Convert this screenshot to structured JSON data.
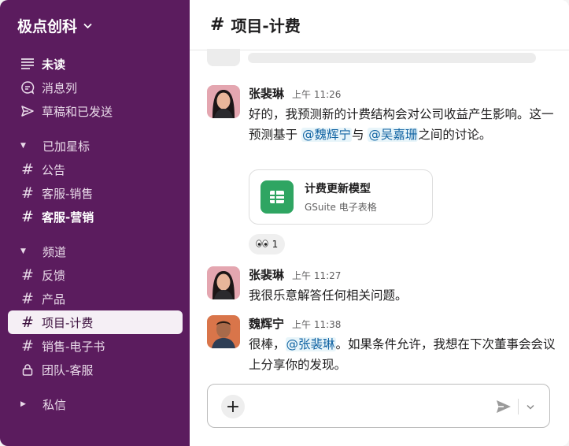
{
  "workspace": {
    "name": "极点创科"
  },
  "sidebar": {
    "top_items": [
      {
        "label": "未读",
        "icon": "unread-icon"
      },
      {
        "label": "消息列",
        "icon": "threads-icon"
      },
      {
        "label": "草稿和已发送",
        "icon": "send-icon"
      }
    ],
    "starred_section": "已加星标",
    "starred": [
      "公告",
      "客服-销售",
      "客服-营销"
    ],
    "channels_section": "频道",
    "channels": [
      "反馈",
      "产品",
      "项目-计费",
      "销售-电子书",
      "团队-客服"
    ],
    "dm_section": "私信"
  },
  "channel": {
    "name": "项目-计费",
    "hash": "#"
  },
  "messages": [
    {
      "author": "张裴琳",
      "time": "上午 11:26",
      "text_a": "好的，我预测新的计费结构会对公司收益产生影响。这一预测基于 ",
      "mention1": "@魏辉宁",
      "text_b": "与 ",
      "mention2": "@吴嘉珊",
      "text_c": "之间的讨论。"
    },
    {
      "author": "张裴琳",
      "time": "上午 11:27",
      "text": "我很乐意解答任何相关问题。"
    },
    {
      "author": "魏辉宁",
      "time": "上午 11:38",
      "text_a": "很棒，",
      "mention1": "@张裴琳",
      "text_b": "。如果条件允许，我想在下次董事会会议上分享你的发现。"
    }
  ],
  "attachment": {
    "title": "计费更新模型",
    "subtitle": "GSuite 电子表格"
  },
  "reaction": {
    "emoji": "👀",
    "count": "1"
  },
  "composer": {
    "plus": "+"
  },
  "colors": {
    "sidebar": "#5b1c5e",
    "mention": "#1264a3",
    "sheets": "#2fa562"
  }
}
